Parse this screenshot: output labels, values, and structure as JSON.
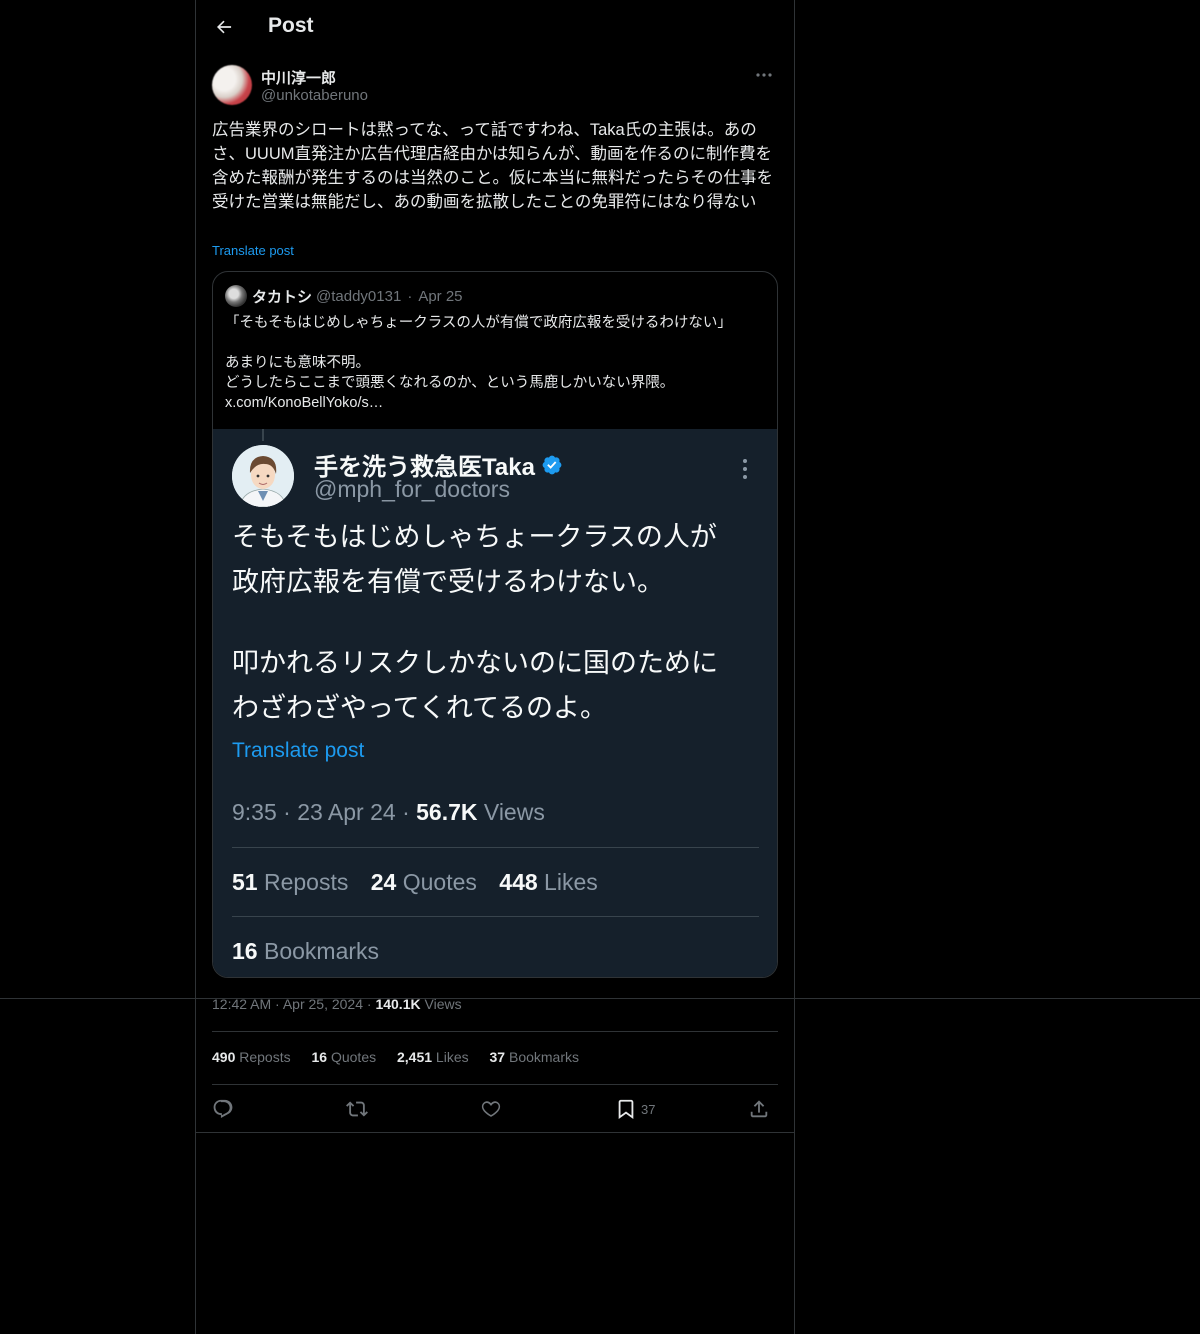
{
  "header": {
    "title": "Post"
  },
  "author": {
    "name": "中川淳一郎",
    "handle": "@unkotaberuno"
  },
  "post": {
    "text": "広告業界のシロートは黙ってな、って話ですわね、Taka氏の主張は。あのさ、UUUM直発注か広告代理店経由かは知らんが、動画を作るのに制作費を含めた報酬が発生するのは当然のこと。仮に本当に無料だったらその仕事を受けた営業は無能だし、あの動画を拡散したことの免罪符にはなり得ない",
    "translate_label": "Translate post"
  },
  "quote": {
    "name": "タカトシ",
    "handle": "@taddy0131",
    "separator": "·",
    "date": "Apr 25",
    "text": "「そもそもはじめしゃちょークラスの人が有償で政府広報を受けるわけない」\n\nあまりにも意味不明。\nどうしたらここまで頭悪くなれるのか、という馬鹿しかいない界隈。\nx.com/KonoBellYoko/s…",
    "screenshot": {
      "name": "手を洗う救急医Taka",
      "handle": "@mph_for_doctors",
      "text_line1": "そもそもはじめしゃちょークラスの人が",
      "text_line2": "政府広報を有償で受けるわけない。",
      "text_line3": "叩かれるリスクしかないのに国のために",
      "text_line4": "わざわざやってくれてるのよ。",
      "translate_label": "Translate post",
      "time": "9:35 · 23 Apr 24 · ",
      "views_count": "56.7K",
      "views_label": " Views",
      "reposts_count": "51",
      "reposts_label": " Reposts",
      "quotes_count": "24",
      "quotes_label": " Quotes",
      "likes_count": "448",
      "likes_label": " Likes",
      "bookmarks_count": "16",
      "bookmarks_label": " Bookmarks",
      "verified_color": "#1d9bf0"
    }
  },
  "meta": {
    "time": "12:42 AM",
    "sep": " · ",
    "date": "Apr 25, 2024",
    "views_count": "140.1K",
    "views_label": " Views"
  },
  "stats": {
    "reposts_count": "490",
    "reposts_label": " Reposts",
    "quotes_count": "16",
    "quotes_label": " Quotes",
    "likes_count": "2,451",
    "likes_label": " Likes",
    "bookmarks_count": "37",
    "bookmarks_label": " Bookmarks"
  },
  "actions": {
    "reply_icon": "reply-icon",
    "repost_icon": "repost-icon",
    "like_icon": "heart-icon",
    "bookmark_icon": "bookmark-icon",
    "bookmark_count": "37",
    "share_icon": "share-icon"
  },
  "colors": {
    "background": "#000000",
    "accent": "#1d9bf0",
    "muted": "#71767b",
    "card": "#15202b"
  }
}
